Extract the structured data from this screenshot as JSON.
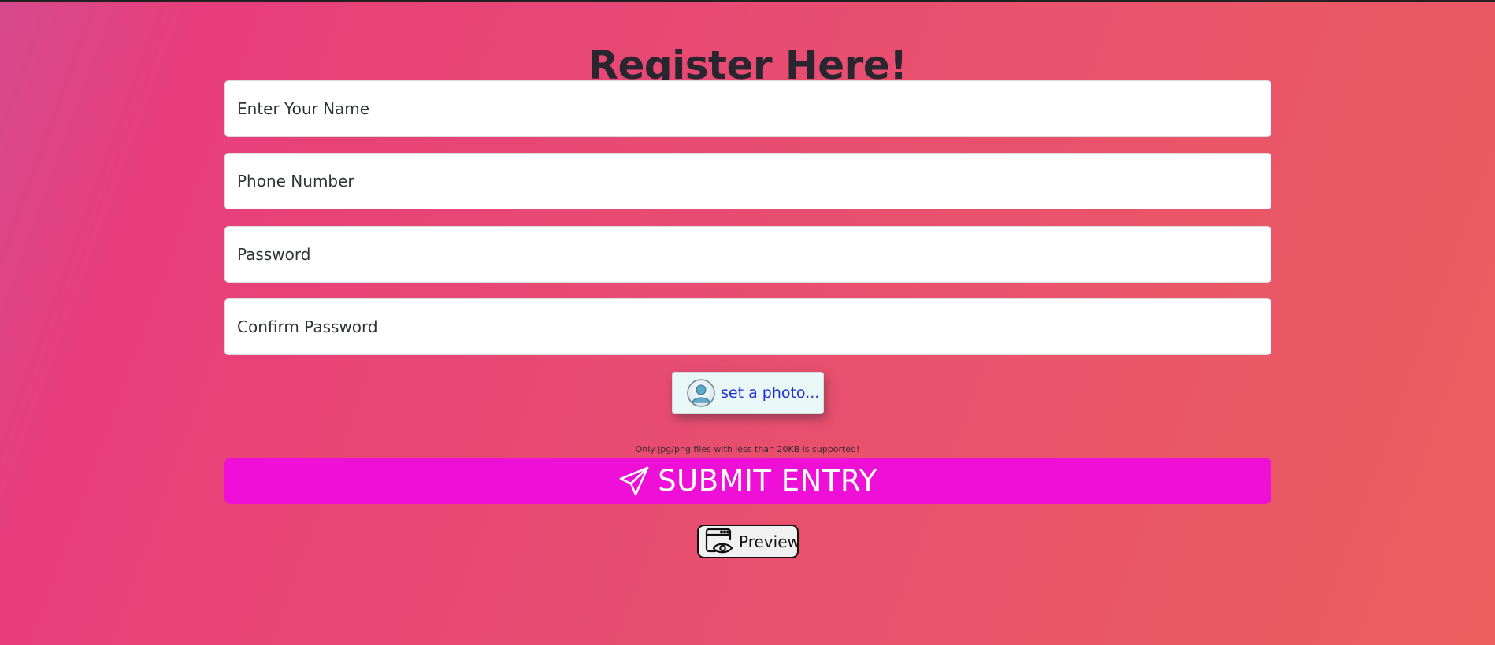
{
  "page": {
    "title": "Register Here!"
  },
  "form": {
    "name_placeholder": "Enter Your Name",
    "phone_placeholder": "Phone Number",
    "password_placeholder": "Password",
    "confirm_password_placeholder": "Confirm Password",
    "photo_button_label": "set a photo...",
    "photo_hint": "Only jpg/png files with less than 20KB is supported!",
    "submit_label": "SUBMIT ENTRY",
    "preview_label": "Preview"
  },
  "icons": {
    "avatar": "avatar-icon",
    "submit": "paper-plane-icon",
    "preview": "browser-eye-icon"
  },
  "colors": {
    "submit_background": "#ee10d6",
    "photo_label": "#1e2fd6"
  }
}
